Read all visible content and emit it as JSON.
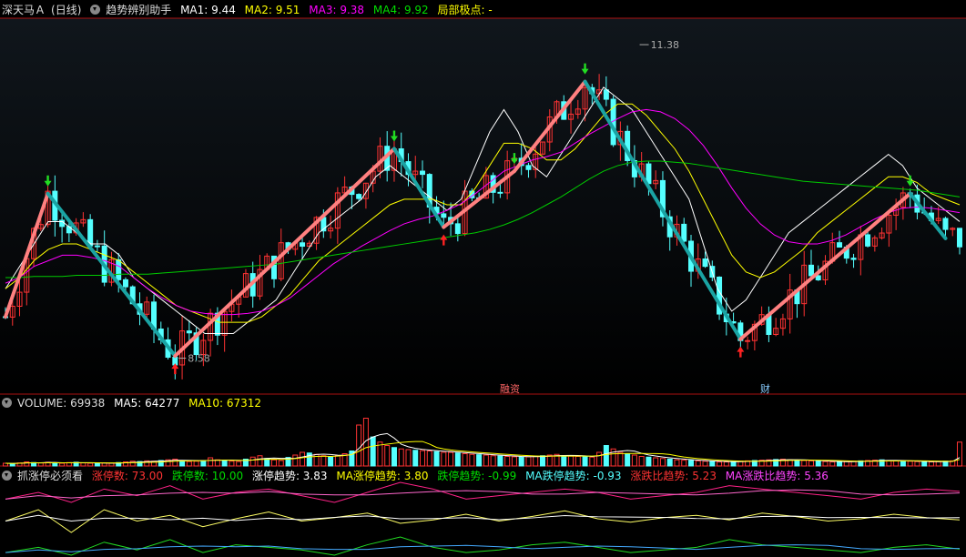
{
  "main_header": {
    "stock": "深天马Ａ",
    "period": "(日线)",
    "indicator": "趋势辨别助手",
    "ma1": "MA1: 9.44",
    "ma2": "MA2: 9.51",
    "ma3": "MA3: 9.38",
    "ma4": "MA4: 9.92",
    "local_extreme": "局部极点: -"
  },
  "volume_header": {
    "volume": "VOLUME: 69938",
    "ma5": "MA5: 64277",
    "ma10": "MA10: 67312"
  },
  "limit_header": {
    "name": "抓涨停必须看",
    "up_count": "涨停数: 73.00",
    "down_count": "跌停数: 10.00",
    "up_trend": "涨停趋势: 3.83",
    "ma_up_trend": "MA涨停趋势: 3.80",
    "down_trend": "跌停趋势: -0.99",
    "ma_down_trend": "MA跌停趋势: -0.93",
    "ratio_trend": "涨跌比趋势: 5.23",
    "ma_ratio_trend": "MA涨跌比趋势: 5.36"
  },
  "colors": {
    "up_candle": "#ff3333",
    "down_candle": "#54ffff",
    "ma1": "#ffffff",
    "ma2": "#ffff00",
    "ma3": "#ff00ff",
    "ma4": "#00cc00",
    "trend_up": "#ff8080",
    "trend_down": "#1aa3a3"
  },
  "chart_data": [
    {
      "type": "candlestick",
      "title": "",
      "ylim": [
        8.3,
        11.6
      ],
      "annotations": [
        {
          "label": "11.38",
          "value": 11.38
        },
        {
          "label": "8.58",
          "value": 8.58
        },
        {
          "label": "融资",
          "value": null
        },
        {
          "label": "财",
          "value": null
        }
      ],
      "trend_line": [
        {
          "index": 0,
          "value": 8.95
        },
        {
          "index": 6,
          "value": 10.05
        },
        {
          "index": 24,
          "value": 8.6
        },
        {
          "index": 55,
          "value": 10.45
        },
        {
          "index": 62,
          "value": 9.75
        },
        {
          "index": 72,
          "value": 10.25
        },
        {
          "index": 82,
          "value": 11.05
        },
        {
          "index": 104,
          "value": 8.75
        },
        {
          "index": 128,
          "value": 10.05
        },
        {
          "index": 133,
          "value": 9.65
        }
      ],
      "series": [
        {
          "name": "MA1",
          "values": [
            9.2,
            9.4,
            9.6,
            9.8,
            9.8,
            9.7,
            9.6,
            9.6,
            9.5,
            9.3,
            9.2,
            9.1,
            9.0,
            8.9,
            8.8,
            8.8,
            8.8,
            8.9,
            9.0,
            9.1,
            9.3,
            9.5,
            9.7,
            9.8,
            9.9,
            10.0,
            10.2,
            10.3,
            10.2,
            10.1,
            10.0,
            9.9,
            10.0,
            10.3,
            10.6,
            10.8,
            10.6,
            10.3,
            10.2,
            10.4,
            10.6,
            10.8,
            11.0,
            10.9,
            10.8,
            10.6,
            10.4,
            10.2,
            10.0,
            9.6,
            9.2,
            9.0,
            9.1,
            9.3,
            9.5,
            9.7,
            9.8,
            9.9,
            10.0,
            10.1,
            10.2,
            10.3,
            10.4,
            10.3,
            10.1,
            10.0,
            9.9,
            9.8
          ]
        },
        {
          "name": "MA2",
          "values": [
            9.2,
            9.3,
            9.45,
            9.55,
            9.6,
            9.6,
            9.55,
            9.5,
            9.45,
            9.35,
            9.25,
            9.15,
            9.05,
            9.0,
            8.95,
            8.9,
            8.9,
            8.9,
            8.95,
            9.05,
            9.15,
            9.3,
            9.45,
            9.55,
            9.65,
            9.75,
            9.85,
            9.95,
            10.0,
            10.0,
            10.0,
            9.95,
            9.95,
            10.1,
            10.3,
            10.5,
            10.5,
            10.45,
            10.35,
            10.35,
            10.45,
            10.6,
            10.75,
            10.85,
            10.85,
            10.75,
            10.6,
            10.45,
            10.25,
            10.0,
            9.75,
            9.5,
            9.35,
            9.3,
            9.35,
            9.45,
            9.55,
            9.7,
            9.8,
            9.9,
            10.0,
            10.1,
            10.2,
            10.2,
            10.15,
            10.05,
            10.0,
            9.95
          ]
        },
        {
          "name": "MA3",
          "values": [
            9.25,
            9.3,
            9.4,
            9.45,
            9.5,
            9.5,
            9.48,
            9.45,
            9.4,
            9.3,
            9.2,
            9.12,
            9.05,
            9.0,
            8.98,
            8.97,
            8.97,
            8.98,
            9.0,
            9.05,
            9.12,
            9.22,
            9.32,
            9.42,
            9.5,
            9.58,
            9.65,
            9.72,
            9.78,
            9.82,
            9.85,
            9.9,
            9.96,
            10.05,
            10.15,
            10.25,
            10.3,
            10.35,
            10.38,
            10.42,
            10.5,
            10.58,
            10.65,
            10.72,
            10.78,
            10.8,
            10.78,
            10.72,
            10.62,
            10.48,
            10.3,
            10.1,
            9.92,
            9.78,
            9.68,
            9.62,
            9.6,
            9.6,
            9.63,
            9.68,
            9.75,
            9.82,
            9.88,
            9.92,
            9.93,
            9.92,
            9.9,
            9.88
          ]
        },
        {
          "name": "MA4",
          "values": [
            9.3,
            9.3,
            9.31,
            9.31,
            9.31,
            9.32,
            9.32,
            9.32,
            9.33,
            9.33,
            9.33,
            9.34,
            9.35,
            9.36,
            9.37,
            9.38,
            9.39,
            9.4,
            9.41,
            9.42,
            9.44,
            9.46,
            9.48,
            9.5,
            9.52,
            9.54,
            9.56,
            9.58,
            9.6,
            9.62,
            9.64,
            9.66,
            9.68,
            9.7,
            9.73,
            9.77,
            9.82,
            9.88,
            9.95,
            10.02,
            10.1,
            10.18,
            10.25,
            10.3,
            10.33,
            10.34,
            10.34,
            10.33,
            10.32,
            10.3,
            10.28,
            10.26,
            10.24,
            10.22,
            10.2,
            10.18,
            10.16,
            10.15,
            10.14,
            10.13,
            10.12,
            10.11,
            10.1,
            10.09,
            10.08,
            10.06,
            10.04,
            10.02
          ]
        }
      ]
    },
    {
      "type": "bar",
      "title": "",
      "ylim": [
        0,
        160000
      ],
      "values": [
        8000,
        7000,
        9000,
        12000,
        10000,
        9000,
        11000,
        9000,
        8000,
        10000,
        11000,
        9000,
        8000,
        7000,
        9000,
        8000,
        10000,
        12000,
        14000,
        13000,
        15000,
        14000,
        16000,
        18000,
        20000,
        15000,
        13000,
        14000,
        16000,
        24000,
        18000,
        15000,
        14000,
        13000,
        20000,
        26000,
        30000,
        22000,
        18000,
        16000,
        25000,
        32000,
        40000,
        38000,
        34000,
        30000,
        26000,
        30000,
        36000,
        44000,
        120000,
        140000,
        85000,
        70000,
        60000,
        54000,
        50000,
        48000,
        46000,
        45000,
        44000,
        42000,
        40000,
        40000,
        38000,
        36000,
        34000,
        33000,
        32000,
        30000,
        29000,
        28000,
        27000,
        26000,
        27000,
        28000,
        30000,
        32000,
        34000,
        30000,
        29000,
        28000,
        27000,
        26000,
        40000,
        60000,
        50000,
        40000,
        36000,
        32000,
        28000,
        26000,
        24000,
        22000,
        20000,
        18000,
        17000,
        16000,
        15000,
        14000,
        13000,
        12000,
        12000,
        13000,
        14000,
        15000,
        16000,
        17000,
        18000,
        19000,
        20000,
        18000,
        17000,
        16000,
        15000,
        14000,
        13000,
        12000,
        12000,
        13000,
        14000,
        15000,
        16000,
        17000,
        18000,
        16000,
        15000,
        14000,
        14000,
        13000,
        12000,
        12000,
        13000,
        14000,
        15000,
        69938
      ],
      "series": [
        {
          "name": "MA5",
          "values": []
        },
        {
          "name": "MA10",
          "values": []
        }
      ]
    },
    {
      "type": "line",
      "title": "",
      "series": [
        {
          "name": "涨停趋势",
          "values": [
            3.6,
            3.8,
            3.5,
            3.9,
            3.7,
            4.0,
            3.6,
            3.8,
            3.9,
            3.7,
            3.5,
            3.8,
            4.1,
            3.9,
            3.6,
            3.7,
            3.8,
            3.9,
            3.8,
            3.6,
            3.7,
            3.8,
            4.0,
            3.9,
            3.8,
            3.7,
            3.6,
            3.8,
            3.9,
            3.83
          ]
        },
        {
          "name": "跌停趋势",
          "values": [
            -1.0,
            -0.9,
            -1.1,
            -0.9,
            -1.0,
            -0.95,
            -1.05,
            -0.98,
            -0.92,
            -1.0,
            -0.97,
            -0.93,
            -1.02,
            -0.99,
            -0.94,
            -1.0,
            -0.96,
            -0.91,
            -0.98,
            -1.01,
            -0.97,
            -0.95,
            -0.99,
            -0.93,
            -0.96,
            -1.0,
            -0.98,
            -0.94,
            -0.97,
            -0.99
          ]
        },
        {
          "name": "涨跌比趋势",
          "values": [
            5.1,
            5.3,
            5.0,
            5.5,
            5.2,
            5.6,
            5.1,
            5.4,
            5.3,
            5.2,
            5.0,
            5.4,
            5.7,
            5.3,
            5.1,
            5.2,
            5.4,
            5.5,
            5.3,
            5.1,
            5.2,
            5.3,
            5.6,
            5.4,
            5.3,
            5.2,
            5.1,
            5.3,
            5.4,
            5.23
          ]
        }
      ]
    }
  ]
}
